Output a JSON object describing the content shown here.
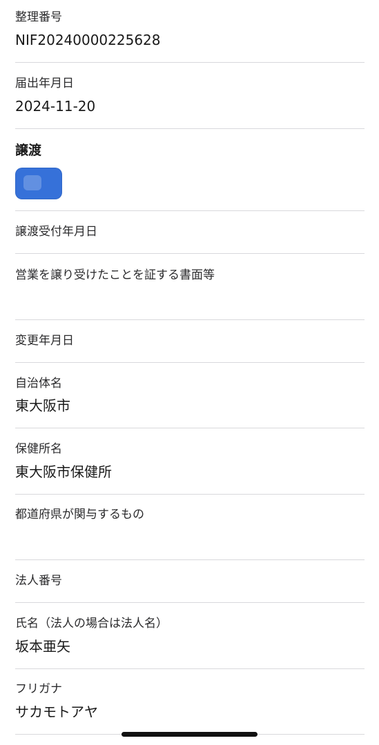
{
  "fields": {
    "seiri_bango": {
      "label": "整理番号",
      "value": "NIF20240000225628"
    },
    "todokede_date": {
      "label": "届出年月日",
      "value": "2024-11-20"
    },
    "joto_section": {
      "title": "譲渡"
    },
    "joto_uketsuke_date": {
      "label": "譲渡受付年月日",
      "value": ""
    },
    "eigyo_shomei": {
      "label": "営業を譲り受けたことを証する書面等",
      "value": ""
    },
    "henko_date": {
      "label": "変更年月日",
      "value": ""
    },
    "jichitai": {
      "label": "自治体名",
      "value": "東大阪市"
    },
    "hokenjo": {
      "label": "保健所名",
      "value": "東大阪市保健所"
    },
    "todofuken": {
      "label": "都道府県が関与するもの",
      "value": ""
    },
    "hojin_bango": {
      "label": "法人番号",
      "value": ""
    },
    "shimei": {
      "label": "氏名（法人の場合は法人名）",
      "value": "坂本亜矢"
    },
    "furigana": {
      "label": "フリガナ",
      "value": "サカモトアヤ"
    }
  },
  "colors": {
    "toggle_blue": "#3671d9",
    "divider": "#d8d8dc"
  }
}
